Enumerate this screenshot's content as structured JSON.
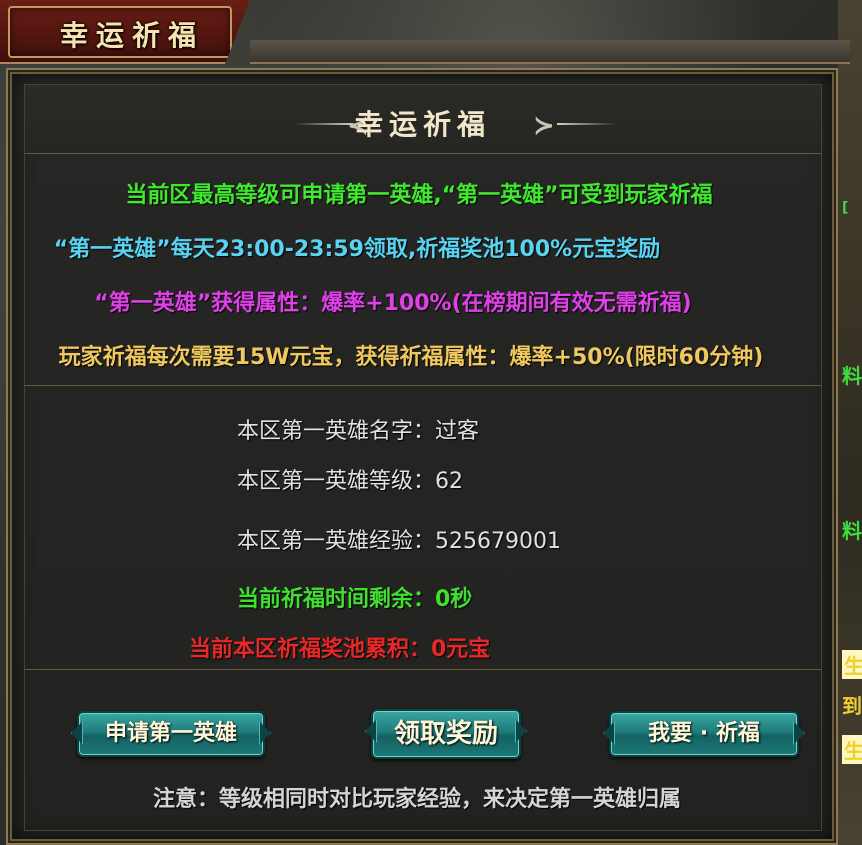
{
  "window": {
    "tab_title": "幸运祈福"
  },
  "header": {
    "title": "幸运祈福",
    "orn_left": "≺",
    "orn_right": "≻"
  },
  "info": {
    "line1": "当前区最高等级可申请第一英雄,“第一英雄”可受到玩家祈福",
    "line2": "“第一英雄”每天23:00-23:59领取,祈福奖池100%元宝奖励",
    "line3": "“第一英雄”获得属性：爆率+100%(在榜期间有效无需祈福)",
    "line4": "玩家祈福每次需要15W元宝，获得祈福属性：爆率+50%(限时60分钟)"
  },
  "stats": {
    "hero_name": "本区第一英雄名字：过客",
    "hero_level": "本区第一英雄等级：62",
    "hero_exp": "本区第一英雄经验：525679001",
    "time_left": "当前祈福时间剩余：0秒",
    "pool": "当前本区祈福奖池累积：0元宝"
  },
  "actions": {
    "apply_label": "申请第一英雄",
    "claim_label": "领取奖励",
    "bless_label": "我要 · 祈福"
  },
  "notice": "注意：等级相同时对比玩家经验，来决定第一英雄归属",
  "side": {
    "g1": "[",
    "g2": "料",
    "g3": "料",
    "g4": "生",
    "g5": "到",
    "g6": "生"
  },
  "colors": {
    "green": "#40e830",
    "cyan": "#5ad2f2",
    "magenta": "#e040e8",
    "gold": "#f0c860",
    "red": "#e82828",
    "button": "#1f7c7c"
  }
}
